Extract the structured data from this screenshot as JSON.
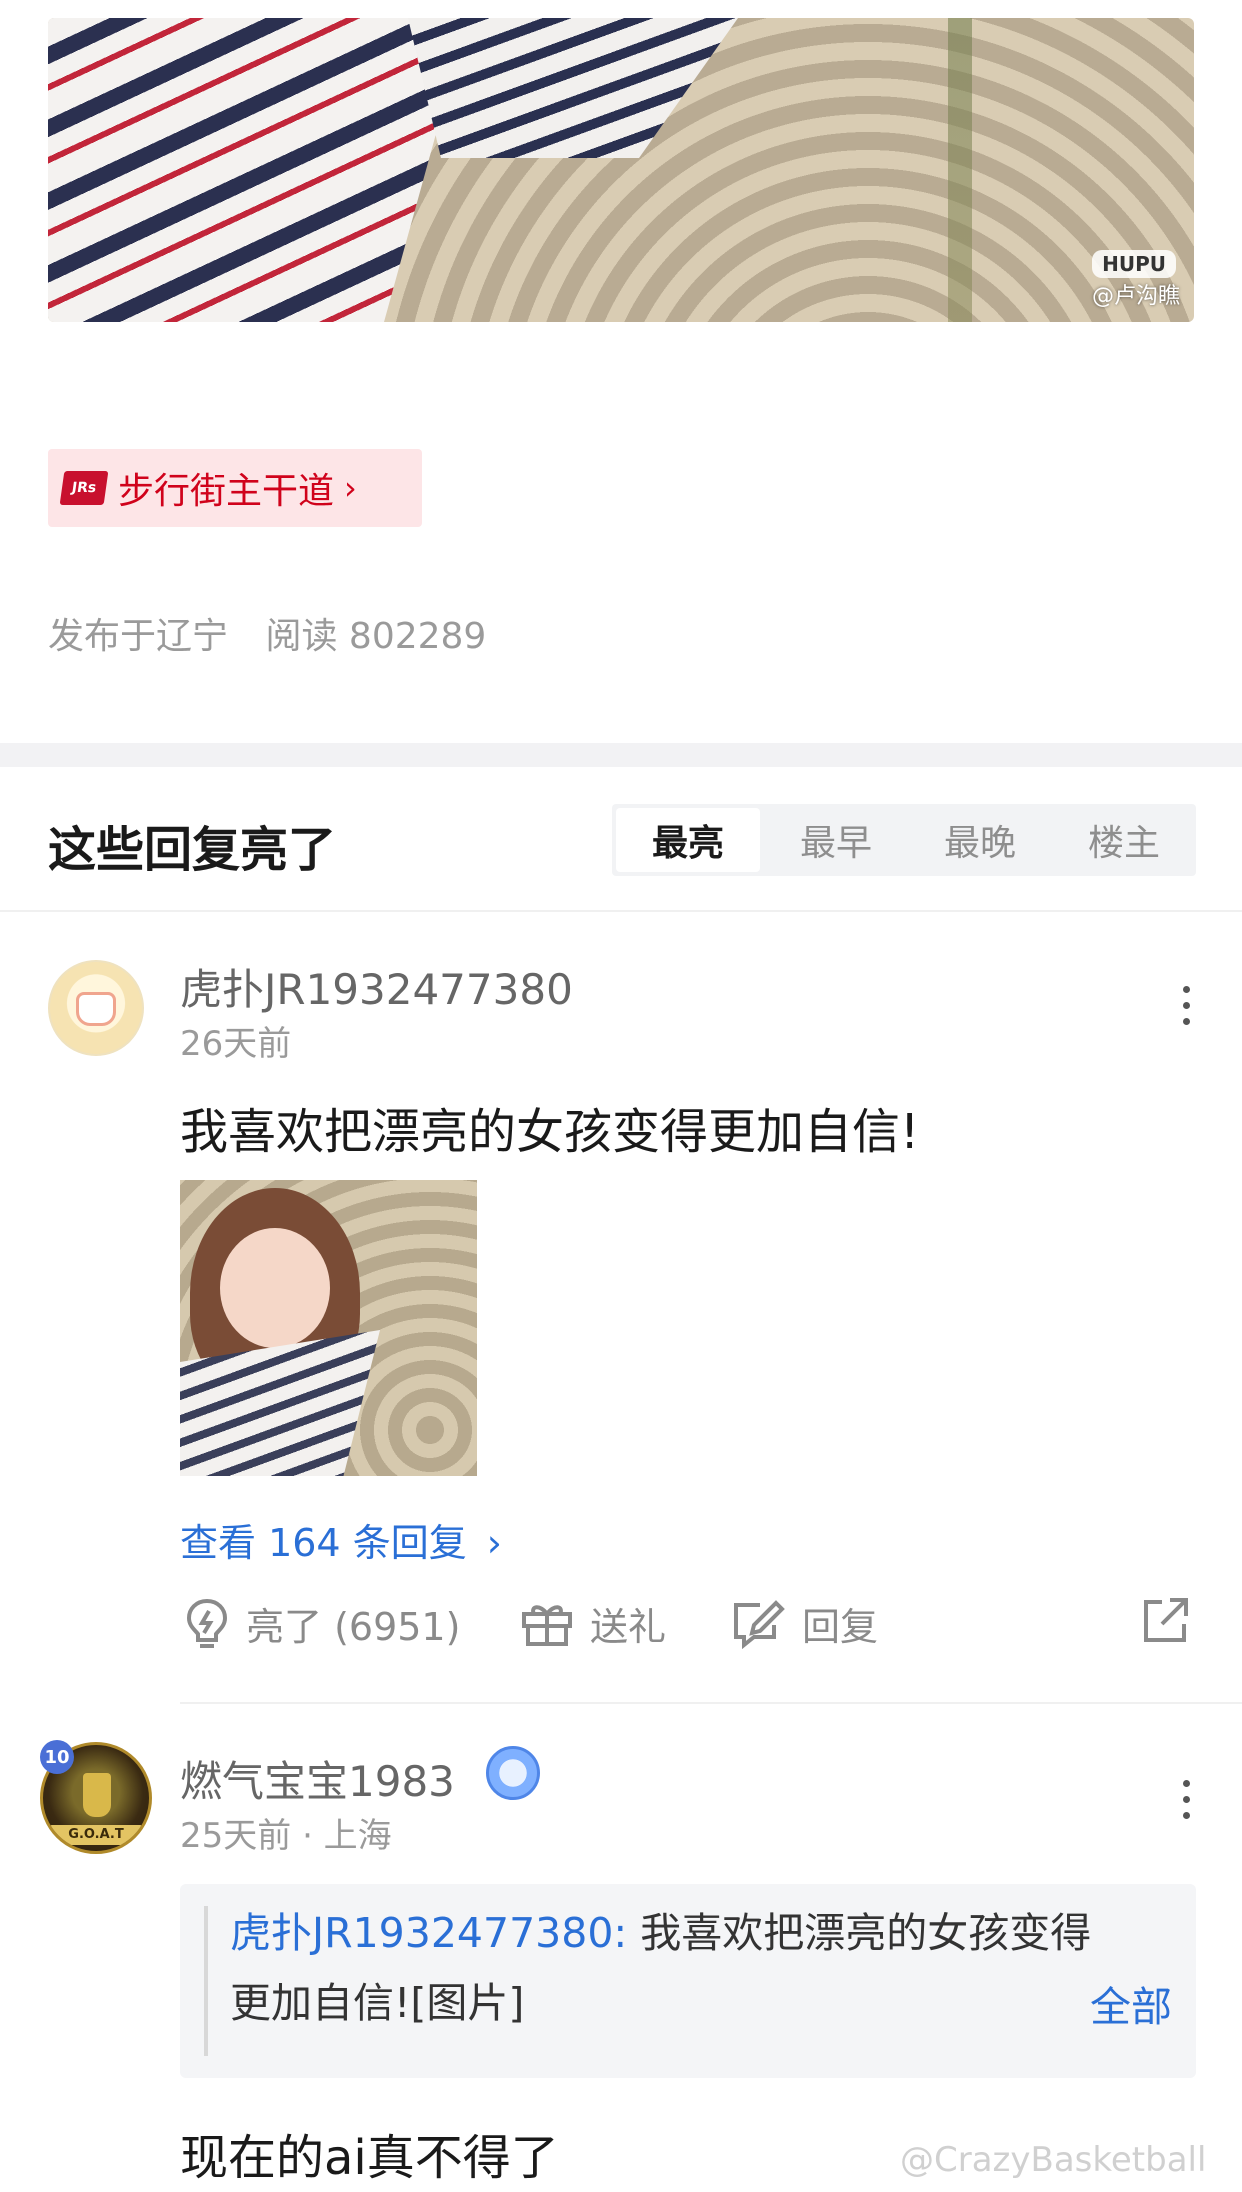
{
  "post": {
    "image_watermark_brand": "HUPU",
    "image_watermark_credit": "@卢沟瞧",
    "topic_label": "步行街主干道",
    "topic_logo_text": "JRs",
    "location": "发布于辽宁",
    "reads": "阅读 802289"
  },
  "replies_section": {
    "title": "这些回复亮了",
    "sort_tabs": [
      "最亮",
      "最早",
      "最晚",
      "楼主"
    ],
    "active_tab": "最亮"
  },
  "comments": [
    {
      "username": "虎扑JR1932477380",
      "time": "26天前",
      "text": "我喜欢把漂亮的女孩变得更加自信!",
      "view_replies": "查看 164 条回复",
      "actions": {
        "like": "亮了 (6951)",
        "gift": "送礼",
        "reply": "回复"
      }
    },
    {
      "username": "燃气宝宝1983",
      "time": "25天前 · 上海",
      "avatar_badge": "10",
      "avatar_caption": "G.O.A.T",
      "quote": {
        "user": "虎扑JR1932477380:",
        "text": "我喜欢把漂亮的女孩变得更加自信![图片]",
        "expand": "全部"
      },
      "text": "现在的ai真不得了"
    }
  ],
  "watermark": "@CrazyBasketball"
}
